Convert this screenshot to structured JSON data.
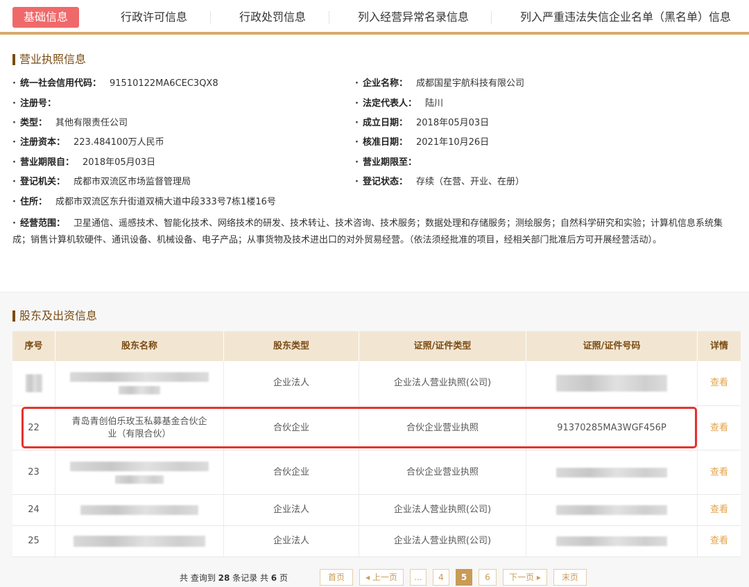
{
  "tabs": [
    {
      "label": "基础信息",
      "active": true
    },
    {
      "label": "行政许可信息",
      "active": false
    },
    {
      "label": "行政处罚信息",
      "active": false
    },
    {
      "label": "列入经营异常名录信息",
      "active": false
    },
    {
      "label": "列入严重违法失信企业名单（黑名单）信息",
      "active": false
    }
  ],
  "license": {
    "title": "营业执照信息",
    "bullet": "·",
    "credit_code_label": "统一社会信用代码：",
    "credit_code": "91510122MA6CEC3QX8",
    "company_name_label": "企业名称：",
    "company_name": "成都国星宇航科技有限公司",
    "reg_no_label": "注册号：",
    "reg_no": "",
    "legal_rep_label": "法定代表人：",
    "legal_rep": "陆川",
    "type_label": "类型：",
    "type": "其他有限责任公司",
    "founded_label": "成立日期：",
    "founded": "2018年05月03日",
    "capital_label": "注册资本：",
    "capital": "223.484100万人民币",
    "approved_label": "核准日期：",
    "approved": "2021年10月26日",
    "term_from_label": "营业期限自：",
    "term_from": "2018年05月03日",
    "term_to_label": "营业期限至：",
    "term_to": "",
    "authority_label": "登记机关：",
    "authority": "成都市双流区市场监督管理局",
    "status_label": "登记状态：",
    "status": "存续（在营、开业、在册）",
    "address_label": "住所：",
    "address": "成都市双流区东升街道双楠大道中段333号7栋1楼16号",
    "scope_label": "经营范围：",
    "scope": "卫星通信、遥感技术、智能化技术、网络技术的研发、技术转让、技术咨询、技术服务；数据处理和存储服务；测绘服务；自然科学研究和实验；计算机信息系统集成；销售计算机软硬件、通讯设备、机械设备、电子产品；从事货物及技术进出口的对外贸易经营。（依法须经批准的项目，经相关部门批准后方可开展经营活动）。"
  },
  "shareholders": {
    "title": "股东及出资信息",
    "columns": [
      "序号",
      "股东名称",
      "股东类型",
      "证照/证件类型",
      "证照/证件号码",
      "详情"
    ],
    "rows": [
      {
        "no": "",
        "name": "",
        "type": "企业法人",
        "cert_type": "企业法人营业执照(公司)",
        "cert_no": "",
        "detail": "查看"
      },
      {
        "no": "22",
        "name": "青岛青创伯乐玫玉私募基金合伙企业（有限合伙）",
        "type": "合伙企业",
        "cert_type": "合伙企业营业执照",
        "cert_no": "91370285MA3WGF456P",
        "detail": "查看"
      },
      {
        "no": "23",
        "name": "",
        "type": "合伙企业",
        "cert_type": "合伙企业营业执照",
        "cert_no": "",
        "detail": "查看"
      },
      {
        "no": "24",
        "name": "",
        "type": "企业法人",
        "cert_type": "企业法人营业执照(公司)",
        "cert_no": "",
        "detail": "查看"
      },
      {
        "no": "25",
        "name": "",
        "type": "企业法人",
        "cert_type": "企业法人营业执照(公司)",
        "cert_no": "",
        "detail": "查看"
      }
    ]
  },
  "pagination": {
    "info_prefix": "共 查询到 ",
    "total": "28",
    "info_mid": " 条记录 共 ",
    "pages": "6",
    "info_suffix": " 页",
    "first": "首页",
    "prev": "◂ 上一页",
    "ellipsis": "...",
    "page_4": "4",
    "page_5": "5",
    "page_6": "6",
    "next": "下一页 ▸",
    "last": "末页"
  },
  "colors": {
    "tab_active": "#f0696a",
    "accent_brown": "#7a4b12",
    "link": "#e4a248",
    "highlight": "#e5322d"
  }
}
